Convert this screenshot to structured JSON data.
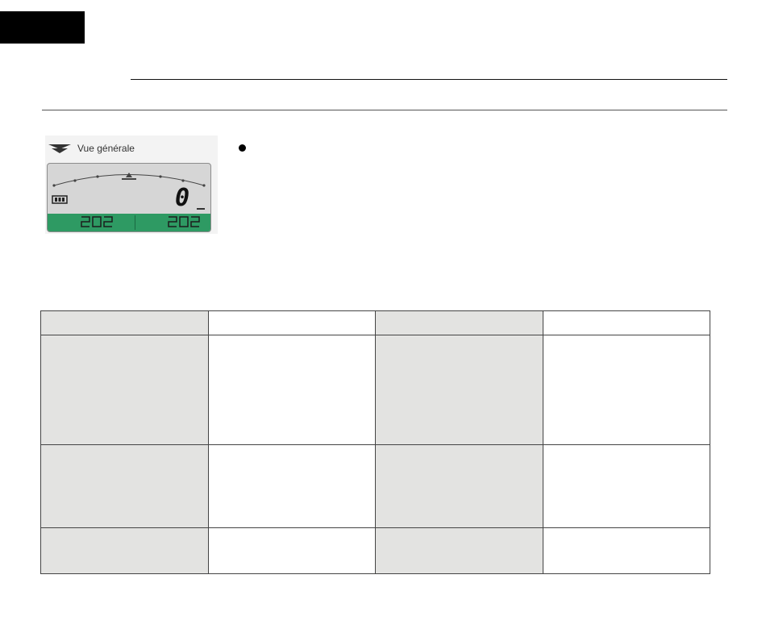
{
  "panel": {
    "caption": "Vue générale",
    "lcd_value": "0"
  },
  "colors": {
    "lcd_background": "#d6d6d6",
    "lcd_band": "#2e9a63",
    "table_shade": "#e3e3e1"
  },
  "table": {
    "rows": [
      [
        "",
        "",
        "",
        ""
      ],
      [
        "",
        "",
        "",
        ""
      ],
      [
        "",
        "",
        "",
        ""
      ],
      [
        "",
        "",
        "",
        ""
      ]
    ]
  }
}
